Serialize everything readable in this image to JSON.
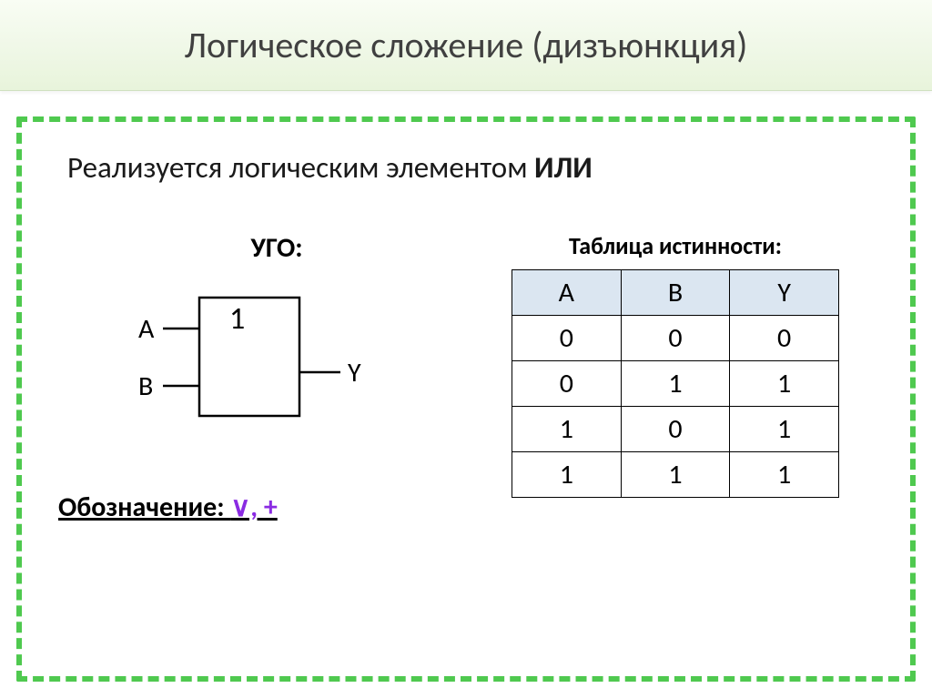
{
  "header": {
    "title": "Логическое сложение (дизъюнкция)"
  },
  "subtitle_prefix": "Реализуется логическим элементом ",
  "subtitle_bold": "ИЛИ",
  "ugo_label": "УГО:",
  "gate": {
    "input_a": "A",
    "input_b": "B",
    "output": "Y",
    "symbol": "1"
  },
  "notation_label": "Обозначение: ",
  "notation_symbols": "∨, +",
  "truth_table_label": "Таблица истинности:",
  "chart_data": {
    "type": "table",
    "title": "Таблица истинности",
    "columns": [
      "A",
      "B",
      "Y"
    ],
    "rows": [
      [
        0,
        0,
        0
      ],
      [
        0,
        1,
        1
      ],
      [
        1,
        0,
        1
      ],
      [
        1,
        1,
        1
      ]
    ]
  }
}
